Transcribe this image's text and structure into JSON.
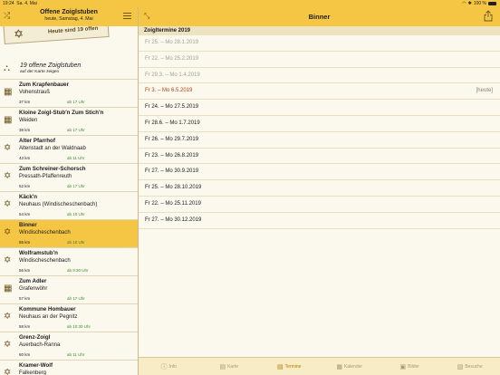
{
  "statusbar": {
    "time": "19:24",
    "date": "Sa. 4. Mai",
    "battery": "100 %"
  },
  "left_header": {
    "title": "Offene Zoiglstuben",
    "subtitle": "heute, Samstag, 4. Mai"
  },
  "banner": {
    "text": "Heute sind 19 offen"
  },
  "overview": {
    "title": "19 offene Zoiglstuben",
    "subtitle": "auf der Karte zeigen"
  },
  "list": [
    {
      "name": "Zum Krapfenbauer",
      "place": "Vohenstrauß",
      "distance": "37 km",
      "open": "ab 17 Uhr",
      "icon": "beer-mug-icon",
      "glyph": "▦"
    },
    {
      "name": "Kloine Zoigl-Stub'n Zum Stich'n",
      "place": "Weiden",
      "distance": "38 km",
      "open": "ab 17 Uhr",
      "icon": "beer-mug-icon",
      "glyph": "▦"
    },
    {
      "name": "Alter Pfarrhof",
      "place": "Altenstadt an der Waldnaab",
      "distance": "43 km",
      "open": "ab 11 Uhr",
      "icon": "zoigl-star-icon",
      "glyph": "✡"
    },
    {
      "name": "Zum Schreiner-Schorsch",
      "place": "Pressath-Pfaffenreuth",
      "distance": "52 km",
      "open": "ab 17 Uhr",
      "icon": "zoigl-star-icon",
      "glyph": "✡"
    },
    {
      "name": "Käck'n",
      "place": "Neuhaus (Windischeschenbach)",
      "distance": "54 km",
      "open": "ab 10 Uhr",
      "icon": "zoigl-star-icon",
      "glyph": "✡"
    },
    {
      "name": "Binner",
      "place": "Windischeschenbach",
      "distance": "55 km",
      "open": "ab 10 Uhr",
      "icon": "zoigl-star-icon",
      "glyph": "✡"
    },
    {
      "name": "Wolframstub'n",
      "place": "Windischeschenbach",
      "distance": "56 km",
      "open": "ab 9:30 Uhr",
      "icon": "zoigl-star-icon",
      "glyph": "✡"
    },
    {
      "name": "Zum Adler",
      "place": "Grafenwöhr",
      "distance": "57 km",
      "open": "ab 17 Uhr",
      "icon": "beer-mug-icon",
      "glyph": "▦"
    },
    {
      "name": "Kommune Hombauer",
      "place": "Neuhaus an der Pegnitz",
      "distance": "58 km",
      "open": "ab 10:30 Uhr",
      "icon": "zoigl-star-icon",
      "glyph": "✡"
    },
    {
      "name": "Grenz-Zoigl",
      "place": "Auerbach-Ranna",
      "distance": "60 km",
      "open": "ab 11 Uhr",
      "icon": "zoigl-star-icon",
      "glyph": "✡"
    },
    {
      "name": "Kramer-Wolf",
      "place": "Falkenberg",
      "distance": "",
      "open": "",
      "icon": "zoigl-star-icon",
      "glyph": "✡"
    }
  ],
  "detail": {
    "title": "Binner",
    "section": "Zoigltermine 2019",
    "today_label": "[heute]",
    "dates": [
      "Fr 25. – Mo 28.1.2019",
      "Fr 22. – Mo 25.2.2019",
      "Fr 29.3. – Mo 1.4.2019",
      "Fr 3. – Mo 6.5.2019",
      "Fr 24. – Mo 27.5.2019",
      "Fr 28.6. – Mo 1.7.2019",
      "Fr 26. – Mo 29.7.2019",
      "Fr 23. – Mo 26.8.2019",
      "Fr 27. – Mo 30.9.2019",
      "Fr 25. – Mo 28.10.2019",
      "Fr 22. – Mo 25.11.2019",
      "Fr 27. – Mo 30.12.2019"
    ],
    "current_index": 3
  },
  "tabs": [
    {
      "label": "Info",
      "icon": "info-icon",
      "glyph": "ⓘ"
    },
    {
      "label": "Karte",
      "icon": "map-icon",
      "glyph": "▤"
    },
    {
      "label": "Termine",
      "icon": "calendar-list-icon",
      "glyph": "▤"
    },
    {
      "label": "Kalender",
      "icon": "calendar-icon",
      "glyph": "▦"
    },
    {
      "label": "Bilder",
      "icon": "photo-icon",
      "glyph": "▣"
    },
    {
      "label": "Besuche",
      "icon": "visits-icon",
      "glyph": "▧"
    }
  ],
  "active_tab": 2,
  "colors": {
    "accent": "#f5c644",
    "current_date": "#b1410d",
    "open_time": "#3d8c2e"
  }
}
